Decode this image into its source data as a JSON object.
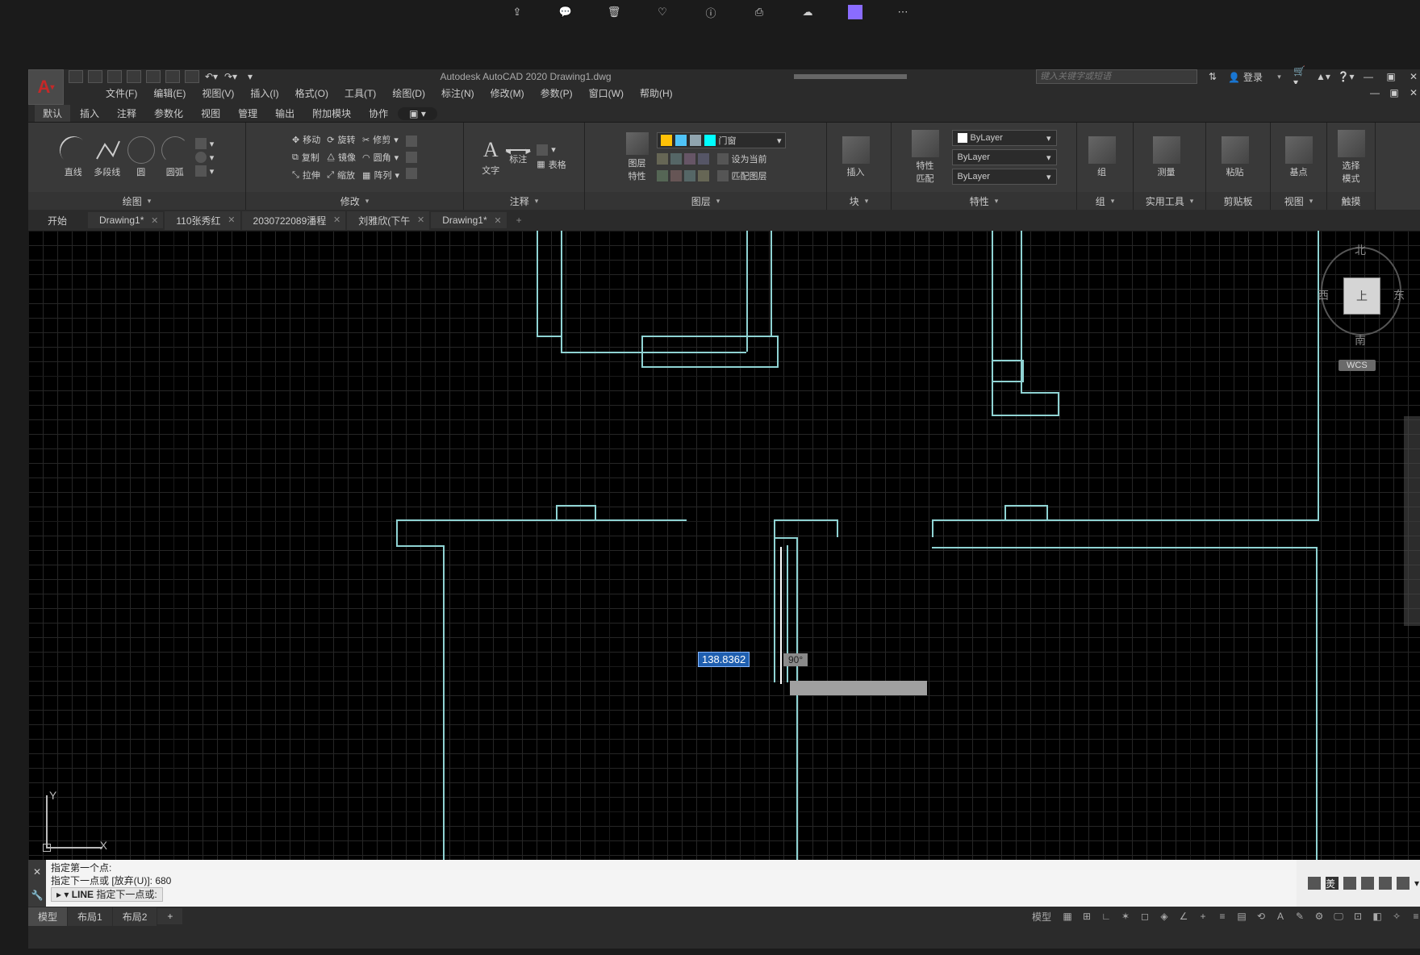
{
  "outer_icons": [
    "share-icon",
    "chat-icon",
    "trash-icon",
    "heart-icon",
    "info-icon",
    "print-icon",
    "cloud-icon",
    "app-icon",
    "more-icon"
  ],
  "title": "Autodesk AutoCAD 2020   Drawing1.dwg",
  "search_placeholder": "键入关键字或短语",
  "login": "登录",
  "menubar": [
    "文件(F)",
    "编辑(E)",
    "视图(V)",
    "插入(I)",
    "格式(O)",
    "工具(T)",
    "绘图(D)",
    "标注(N)",
    "修改(M)",
    "参数(P)",
    "窗口(W)",
    "帮助(H)"
  ],
  "ribtabs": [
    "默认",
    "插入",
    "注释",
    "参数化",
    "视图",
    "管理",
    "输出",
    "附加模块",
    "协作"
  ],
  "panel_draw": {
    "title": "绘图",
    "items": [
      "直线",
      "多段线",
      "圆",
      "圆弧"
    ]
  },
  "panel_modify": {
    "title": "修改",
    "rows": [
      [
        "移动",
        "旋转",
        "修剪"
      ],
      [
        "复制",
        "镜像",
        "圆角"
      ],
      [
        "拉伸",
        "缩放",
        "阵列"
      ]
    ]
  },
  "panel_annot": {
    "title": "注释",
    "items": [
      "文字",
      "标注",
      "表格"
    ]
  },
  "panel_layer": {
    "title": "图层",
    "btn": "图层\n特性",
    "dd": "门窗",
    "rows": [
      "设为当前",
      "匹配图层"
    ]
  },
  "panel_block": {
    "title": "块",
    "btn": "插入"
  },
  "panel_prop": {
    "title": "特性",
    "btn": "特性\n匹配",
    "vals": [
      "ByLayer",
      "ByLayer",
      "ByLayer"
    ]
  },
  "panel_group": {
    "title": "组",
    "btn": "组"
  },
  "panel_util": {
    "title": "实用工具",
    "btn": "测量"
  },
  "panel_clip": {
    "title": "剪贴板",
    "btn": "粘贴"
  },
  "panel_base": {
    "title": "视图",
    "btn": "基点"
  },
  "panel_touch": {
    "title": "触摸",
    "btn": "选择\n模式"
  },
  "filetabs": [
    "开始",
    "Drawing1*",
    "110张秀红",
    "2030722089潘程",
    "刘雅欣(下午",
    "Drawing1*"
  ],
  "dim_value": "138.8362",
  "angle_value": "90°",
  "ucs": {
    "y": "Y",
    "x": "X"
  },
  "viewcube": {
    "n": "北",
    "s": "南",
    "e": "东",
    "w": "西",
    "top": "上",
    "wcs": "WCS"
  },
  "cmd_lines": [
    "指定第一个点:",
    "指定下一点或 [放弃(U)]: 680"
  ],
  "cmd_prompt_cmd": "LINE",
  "cmd_prompt_text": "指定下一点或:",
  "status_tabs": [
    "模型",
    "布局1",
    "布局2"
  ],
  "colors": {
    "accent": "#8fd3d3",
    "sel": "#1f5fb0"
  }
}
